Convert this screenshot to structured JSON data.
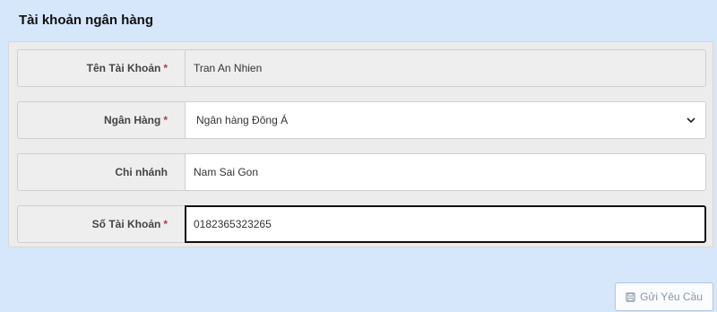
{
  "header": {
    "title": "Tài khoản ngân hàng"
  },
  "form": {
    "account_name": {
      "label": "Tên Tài Khoản",
      "required_mark": "*",
      "value": "Tran An Nhien"
    },
    "bank": {
      "label": "Ngân Hàng",
      "required_mark": "*",
      "selected": "Ngân hàng Đông Á"
    },
    "branch": {
      "label": "Chi nhánh",
      "value": "Nam Sai Gon"
    },
    "account_number": {
      "label": "Số Tài Khoản",
      "required_mark": "*",
      "value": "0182365323265"
    }
  },
  "actions": {
    "submit_label": "Gửi Yêu Cầu",
    "submit_icon": "save-icon"
  },
  "colors": {
    "required": "#a94442",
    "page_bg": "#d6e6fb"
  }
}
